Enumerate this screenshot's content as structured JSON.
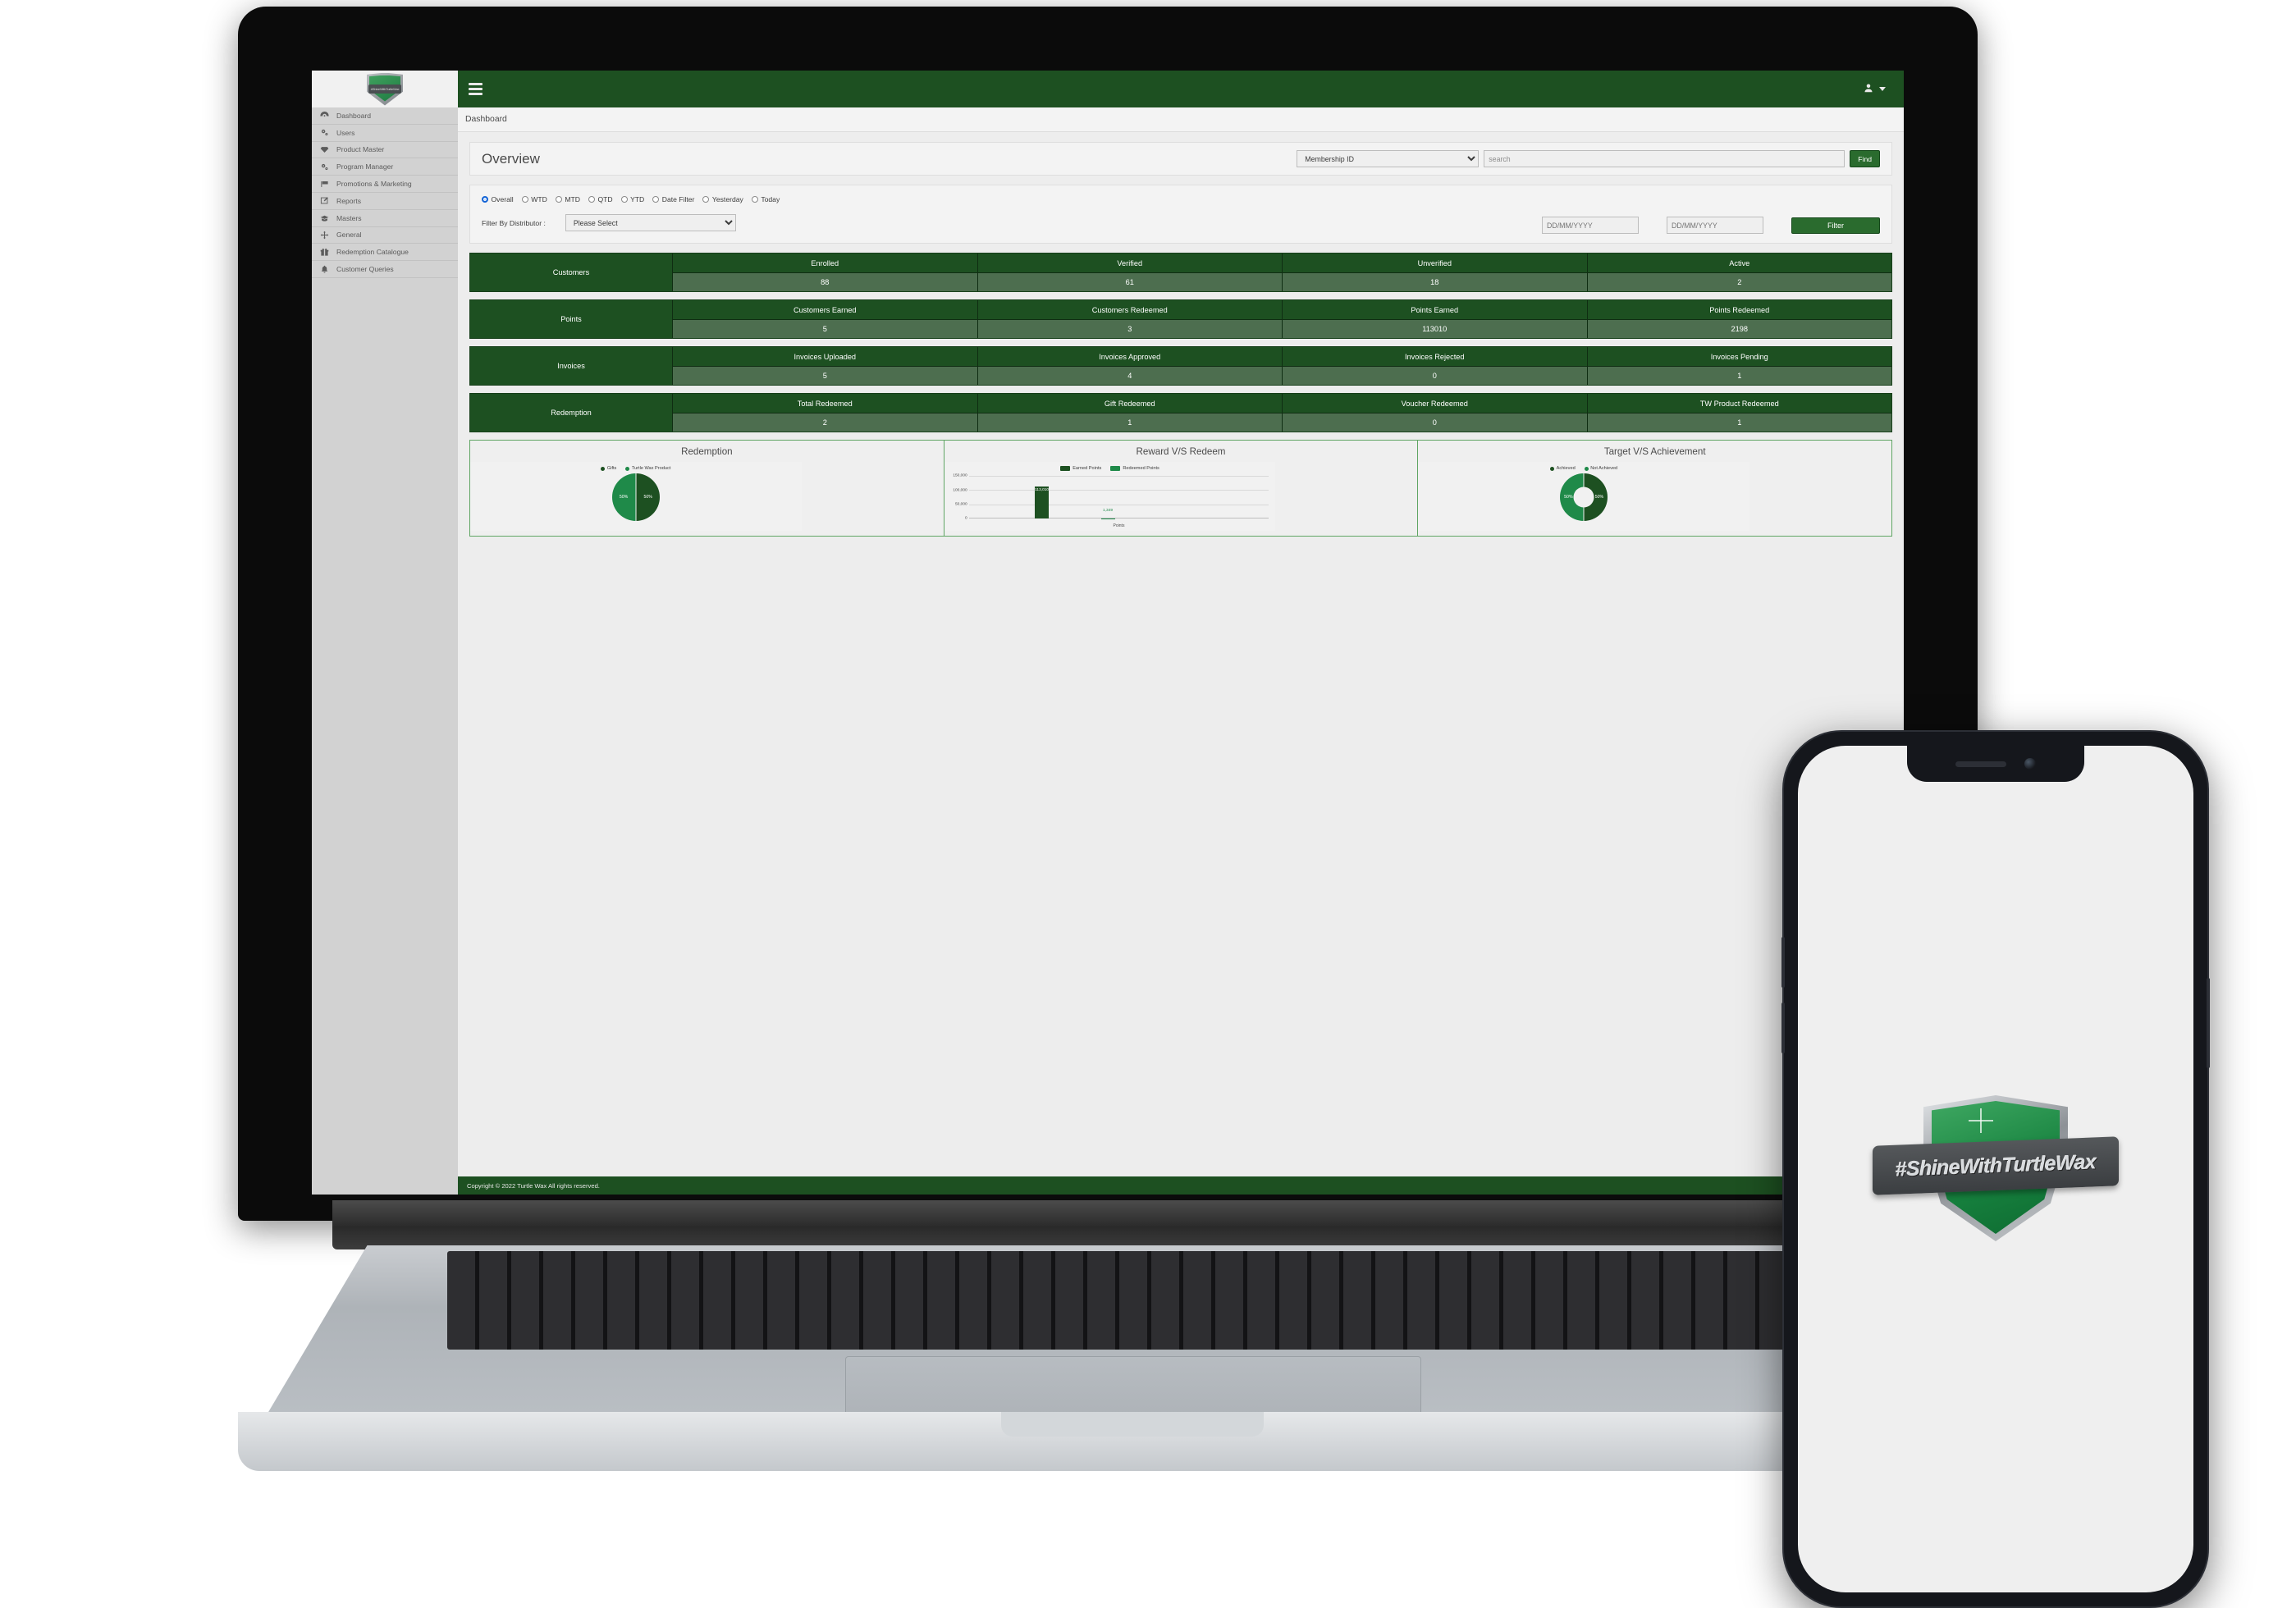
{
  "sidebar": {
    "logo_text": "#ShineWithTurtleWax",
    "items": [
      {
        "label": "Dashboard",
        "icon": "dashboard-icon"
      },
      {
        "label": "Users",
        "icon": "gears-icon"
      },
      {
        "label": "Product Master",
        "icon": "gem-icon"
      },
      {
        "label": "Program Manager",
        "icon": "gears-icon"
      },
      {
        "label": "Promotions & Marketing",
        "icon": "flag-icon"
      },
      {
        "label": "Reports",
        "icon": "edit-icon"
      },
      {
        "label": "Masters",
        "icon": "graduation-cap-icon"
      },
      {
        "label": "General",
        "icon": "arrows-icon"
      },
      {
        "label": "Redemption Catalogue",
        "icon": "gift-icon"
      },
      {
        "label": "Customer Queries",
        "icon": "bell-icon"
      }
    ]
  },
  "topbar": {
    "menu_icon": "hamburger-icon",
    "user_icon": "user-icon",
    "caret_icon": "caret-down-icon"
  },
  "breadcrumb": {
    "text": "Dashboard"
  },
  "overview": {
    "title": "Overview",
    "search_field_selected": "Membership ID",
    "search_field_options": [
      "Membership ID"
    ],
    "search_placeholder": "search",
    "search_value": "",
    "find_label": "Find"
  },
  "filters": {
    "radios": [
      {
        "label": "Overall",
        "selected": true
      },
      {
        "label": "WTD",
        "selected": false
      },
      {
        "label": "MTD",
        "selected": false
      },
      {
        "label": "QTD",
        "selected": false
      },
      {
        "label": "YTD",
        "selected": false
      },
      {
        "label": "Date Filter",
        "selected": false
      },
      {
        "label": "Yesterday",
        "selected": false
      },
      {
        "label": "Today",
        "selected": false
      }
    ],
    "distributor_label": "Filter By Distributor :",
    "distributor_selected": "Please Select",
    "distributor_options": [
      "Please Select"
    ],
    "date_from_placeholder": "DD/MM/YYYY",
    "date_from_value": "",
    "date_to_placeholder": "DD/MM/YYYY",
    "date_to_value": "",
    "filter_button_label": "Filter"
  },
  "stats": [
    {
      "label": "Customers",
      "columns": [
        "Enrolled",
        "Verified",
        "Unverified",
        "Active"
      ],
      "values": [
        "88",
        "61",
        "18",
        "2"
      ]
    },
    {
      "label": "Points",
      "columns": [
        "Customers Earned",
        "Customers Redeemed",
        "Points Earned",
        "Points Redeemed"
      ],
      "values": [
        "5",
        "3",
        "113010",
        "2198"
      ]
    },
    {
      "label": "Invoices",
      "columns": [
        "Invoices Uploaded",
        "Invoices Approved",
        "Invoices Rejected",
        "Invoices Pending"
      ],
      "values": [
        "5",
        "4",
        "0",
        "1"
      ]
    },
    {
      "label": "Redemption",
      "columns": [
        "Total Redeemed",
        "Gift Redeemed",
        "Voucher Redeemed",
        "TW Product Redeemed"
      ],
      "values": [
        "2",
        "1",
        "0",
        "1"
      ]
    }
  ],
  "chart_data": [
    {
      "type": "pie",
      "title": "Redemption",
      "labels": [
        "Gifts",
        "Turtle Wax Product"
      ],
      "values": [
        50,
        50
      ],
      "value_labels": [
        "50%",
        "50%"
      ],
      "colors": [
        "#1d5021",
        "#1f8a49"
      ],
      "legend_position": "top"
    },
    {
      "type": "bar",
      "title": "Reward V/S Redeem",
      "categories": [
        "Points"
      ],
      "xlabel": "Points",
      "ylabel": "",
      "ylim": [
        0,
        150000
      ],
      "yticks": [
        "0",
        "50,000",
        "100,000",
        "150,000"
      ],
      "series": [
        {
          "name": "Earned Points",
          "values": [
            113010
          ],
          "value_labels": [
            "113,010"
          ],
          "color": "#1d5021"
        },
        {
          "name": "Redeemed Points",
          "values": [
            1349
          ],
          "value_labels": [
            "1,349"
          ],
          "color": "#1f8a49"
        }
      ],
      "grid": true,
      "legend_position": "top"
    },
    {
      "type": "pie",
      "title": "Target V/S Achievement",
      "donut": true,
      "labels": [
        "Achieved",
        "Not Achieved"
      ],
      "values": [
        50,
        50
      ],
      "value_labels": [
        "50%",
        "50%"
      ],
      "colors": [
        "#1d5021",
        "#1f8a49"
      ],
      "legend_position": "top"
    }
  ],
  "footer": {
    "text": "Copyright © 2022 Turtle Wax All rights reserved."
  },
  "phone": {
    "logo_text": "#ShineWithTurtleWax"
  },
  "colors": {
    "brand_dark_green": "#1d5021",
    "brand_green": "#1f8a49",
    "value_row_green": "#4d6e4f",
    "accent_blue": "#1464d6"
  }
}
